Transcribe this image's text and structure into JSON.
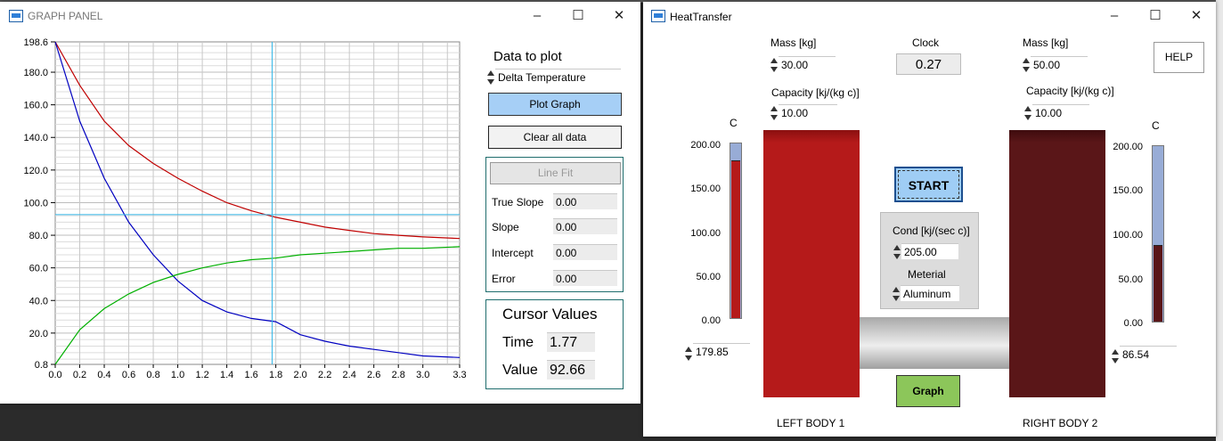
{
  "graph_panel": {
    "title": "GRAPH PANEL",
    "data_to_plot_label": "Data to plot",
    "data_to_plot_value": "Delta Temperature",
    "plot_graph_label": "Plot Graph",
    "clear_all_label": "Clear all data",
    "line_fit": {
      "button_label": "Line Fit",
      "rows": [
        {
          "label": "True Slope",
          "value": "0.00"
        },
        {
          "label": "Slope",
          "value": "0.00"
        },
        {
          "label": "Intercept",
          "value": "0.00"
        },
        {
          "label": "Error",
          "value": "0.00"
        }
      ]
    },
    "cursor": {
      "title": "Cursor Values",
      "time_label": "Time",
      "time_value": "1.77",
      "value_label": "Value",
      "value_value": "92.66"
    },
    "y_ticks": [
      "198.6",
      "180.0",
      "160.0",
      "140.0",
      "120.0",
      "100.0",
      "80.0",
      "60.0",
      "40.0",
      "20.0",
      "0.8"
    ],
    "x_ticks": [
      "0.0",
      "0.2",
      "0.4",
      "0.6",
      "0.8",
      "1.0",
      "1.2",
      "1.4",
      "1.6",
      "1.8",
      "2.0",
      "2.2",
      "2.4",
      "2.6",
      "2.8",
      "3.0",
      "3.3"
    ]
  },
  "chart_data": {
    "type": "line",
    "xlim": [
      0,
      3.3
    ],
    "ylim": [
      0.8,
      198.6
    ],
    "grid": true,
    "cursor": {
      "x": 1.77,
      "y": 92.66
    },
    "series": [
      {
        "color": "#c00000",
        "x": [
          0,
          0.2,
          0.4,
          0.6,
          0.8,
          1.0,
          1.2,
          1.4,
          1.6,
          1.8,
          2.0,
          2.2,
          2.4,
          2.6,
          2.8,
          3.0,
          3.3
        ],
        "y": [
          198.6,
          172,
          150,
          135,
          124,
          115,
          107,
          100,
          95,
          91,
          88,
          85,
          83,
          81,
          80,
          79,
          78
        ]
      },
      {
        "color": "#0000c0",
        "x": [
          0,
          0.2,
          0.4,
          0.6,
          0.8,
          1.0,
          1.2,
          1.4,
          1.6,
          1.8,
          2.0,
          2.2,
          2.4,
          2.6,
          2.8,
          3.0,
          3.3
        ],
        "y": [
          198.6,
          150,
          115,
          88,
          68,
          52,
          40,
          33,
          29,
          27,
          19,
          15,
          12,
          10,
          8,
          6,
          5
        ]
      },
      {
        "color": "#00b000",
        "x": [
          0,
          0.2,
          0.4,
          0.6,
          0.8,
          1.0,
          1.2,
          1.4,
          1.6,
          1.8,
          2.0,
          2.2,
          2.4,
          2.6,
          2.8,
          3.0,
          3.3
        ],
        "y": [
          0.8,
          22,
          35,
          44,
          51,
          56,
          60,
          63,
          65,
          66,
          68,
          69,
          70,
          71,
          72,
          72,
          73
        ]
      }
    ]
  },
  "heat_transfer": {
    "title": "HeatTransfer",
    "left_mass_label": "Mass [kg]",
    "left_mass_value": "30.00",
    "left_capacity_label": "Capacity [kj/(kg c)]",
    "left_capacity_value": "10.00",
    "clock_label": "Clock",
    "clock_value": "0.27",
    "right_mass_label": "Mass [kg]",
    "right_mass_value": "50.00",
    "right_capacity_label": "Capacity  [kj/(kg c)]",
    "right_capacity_value": "10.00",
    "help_label": "HELP",
    "unit_c": "C",
    "gauge_ticks": [
      "200.00",
      "150.00",
      "100.00",
      "50.00",
      "0.00"
    ],
    "left_temp_value": "179.85",
    "right_temp_value": "86.54",
    "left_level": 0.899,
    "right_level": 0.433,
    "start_label": "START",
    "cond_label": "Cond  [kj/(sec c)]",
    "cond_value": "205.00",
    "material_label": "Meterial",
    "material_value": "Aluminum",
    "graph_label": "Graph",
    "left_body_label": "LEFT BODY 1",
    "right_body_label": "RIGHT BODY 2",
    "colors": {
      "left_body": "#b51a1a",
      "right_body": "#5a1618",
      "start": "#9fcdf5",
      "graph": "#8cc65a"
    }
  }
}
